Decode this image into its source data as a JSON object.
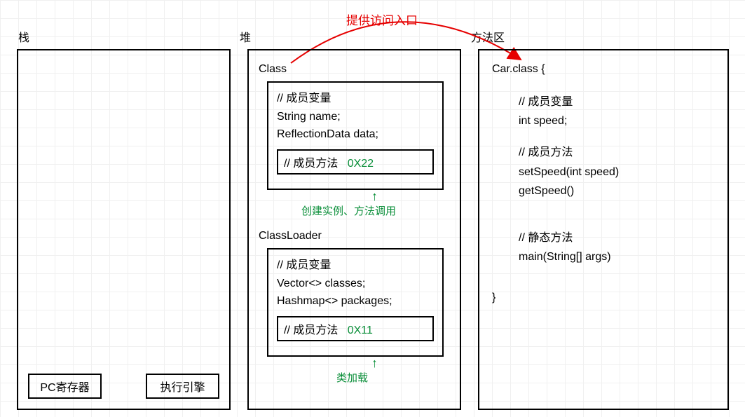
{
  "topAnnotation": "提供访问入口",
  "stack": {
    "title": "栈",
    "pcRegister": "PC寄存器",
    "execEngine": "执行引擎"
  },
  "heap": {
    "title": "堆",
    "classBox": {
      "title": "Class",
      "memberVarComment": "// 成员变量",
      "memberVar1": "String name;",
      "memberVar2": "ReflectionData data;",
      "methodComment": "// 成员方法",
      "methodAddr": "0X22",
      "annotation": "创建实例、方法调用"
    },
    "classLoaderBox": {
      "title": "ClassLoader",
      "memberVarComment": "// 成员变量",
      "memberVar1": "Vector<> classes;",
      "memberVar2": "Hashmap<> packages;",
      "methodComment": "// 成员方法",
      "methodAddr": "0X11",
      "annotation": "类加载"
    }
  },
  "methodArea": {
    "title": "方法区",
    "className": "Car.class {",
    "memberVarComment": "// 成员变量",
    "memberVar1": "int speed;",
    "methodComment": "// 成员方法",
    "method1": "setSpeed(int speed)",
    "method2": "getSpeed()",
    "staticComment": "// 静态方法",
    "staticMethod": "main(String[] args)",
    "closeBrace": "}"
  }
}
